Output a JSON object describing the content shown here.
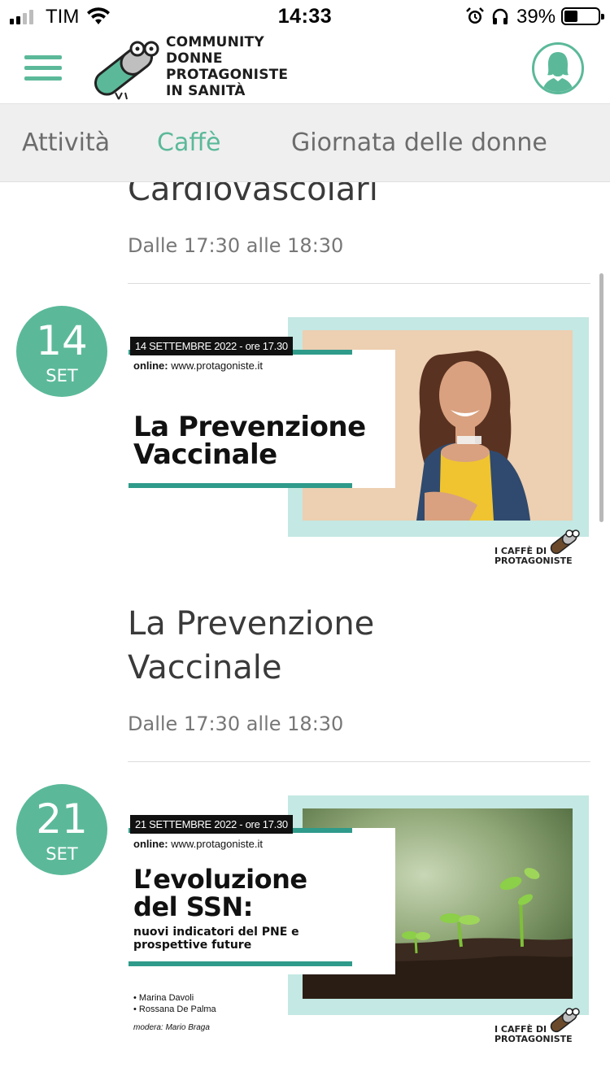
{
  "status_bar": {
    "carrier": "TIM",
    "time": "14:33",
    "battery_percent": "39%",
    "battery_level": 0.39,
    "icons": [
      "signal-icon",
      "wifi-icon",
      "alarm-icon",
      "headphones-icon",
      "battery-icon"
    ]
  },
  "header": {
    "logo_line1": "COMMUNITY",
    "logo_line2": "DONNE",
    "logo_line3": "PROTAGONISTE",
    "logo_line4": "IN SANITÀ",
    "menu_icon": "hamburger-menu-icon",
    "profile_icon": "user-avatar-icon"
  },
  "tabs": [
    {
      "label": "Attività",
      "active": false
    },
    {
      "label": "Caffè",
      "active": true
    },
    {
      "label": "Giornata delle donne",
      "active": false
    }
  ],
  "events": [
    {
      "title_tail": "Cardiovascolari",
      "time": "Dalle 17:30 alle 18:30"
    },
    {
      "day": "14",
      "month": "SET",
      "poster": {
        "date_line": "14 SETTEMBRE 2022 - ore 17.30",
        "online_label": "online:",
        "online_url": "www.protagoniste.it",
        "headline_line1": "La Prevenzione",
        "headline_line2": "Vaccinale",
        "brand_line1": "I CAFFÈ DI",
        "brand_line2": "PROTAGONISTE"
      },
      "title_line1": "La Prevenzione",
      "title_line2": "Vaccinale",
      "time": "Dalle 17:30 alle 18:30"
    },
    {
      "day": "21",
      "month": "SET",
      "poster": {
        "date_line": "21 SETTEMBRE 2022 - ore 17.30",
        "online_label": "online:",
        "online_url": "www.protagoniste.it",
        "headline_line1": "L’evoluzione",
        "headline_line2": "del SSN:",
        "sub_line1": "nuovi indicatori del PNE e",
        "sub_line2": "prospettive future",
        "speaker1": "• Marina Davoli",
        "speaker2": "• Rossana De Palma",
        "moderator": "modera: Mario Braga",
        "brand_line1": "I CAFFÈ DI",
        "brand_line2": "PROTAGONISTE"
      }
    }
  ],
  "colors": {
    "accent": "#5bb99a",
    "tab_bg": "#efefef",
    "poster_frame": "#c4e8e3",
    "poster_line": "#2f9b8a"
  }
}
